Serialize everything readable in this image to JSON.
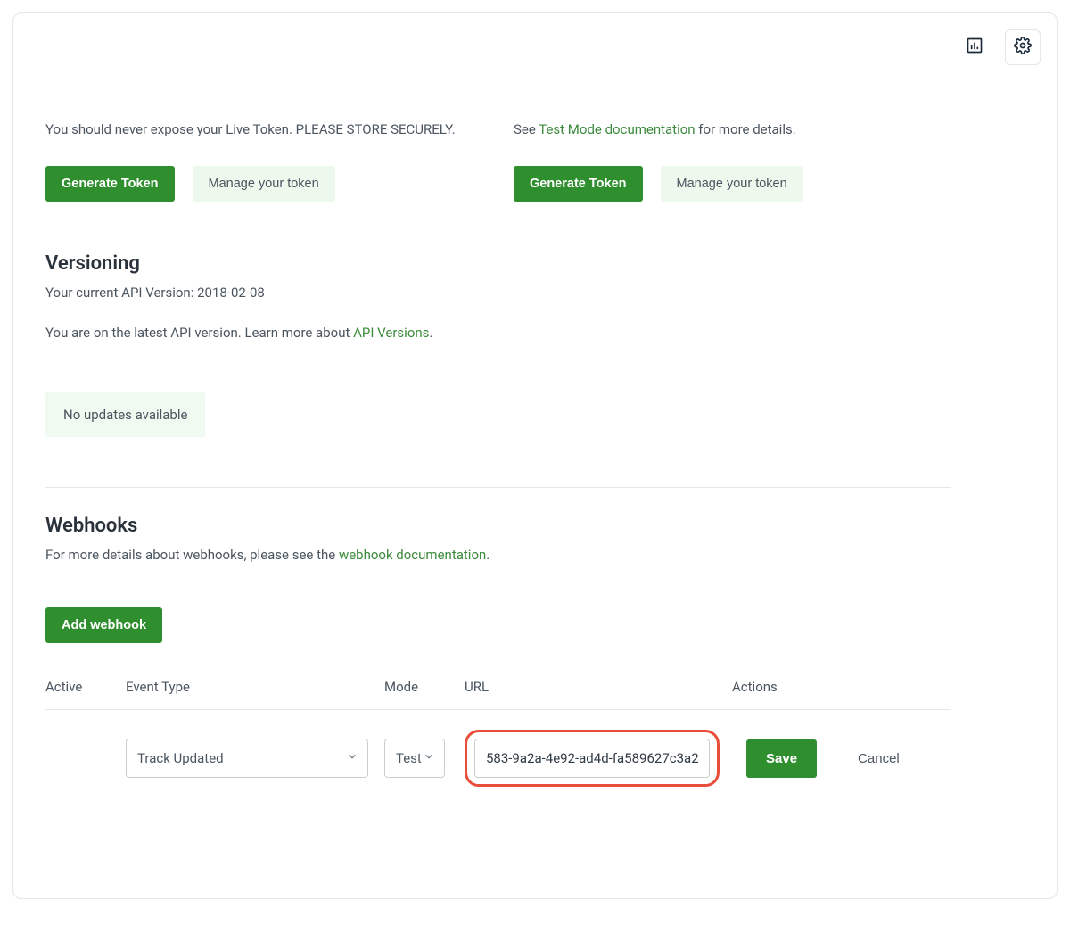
{
  "tokens": {
    "live_desc": "You should never expose your Live Token. PLEASE STORE SECURELY.",
    "test_desc_prefix": "See ",
    "test_desc_link": "Test Mode documentation",
    "test_desc_suffix": " for more details.",
    "generate_label": "Generate Token",
    "manage_label": "Manage your token"
  },
  "versioning": {
    "title": "Versioning",
    "current_prefix": "Your current API Version: ",
    "current_value": "2018-02-08",
    "latest_prefix": "You are on the latest API version. Learn more about ",
    "latest_link": "API Versions",
    "latest_suffix": ".",
    "no_updates": "No updates available"
  },
  "webhooks": {
    "title": "Webhooks",
    "desc_prefix": "For more details about webhooks, please see the ",
    "desc_link": "webhook documentation",
    "desc_suffix": ".",
    "add_label": "Add webhook",
    "headers": {
      "active": "Active",
      "event_type": "Event Type",
      "mode": "Mode",
      "url": "URL",
      "actions": "Actions"
    },
    "row": {
      "event_type": "Track Updated",
      "mode": "Test",
      "url": "583-9a2a-4e92-ad4d-fa589627c3a2",
      "save": "Save",
      "cancel": "Cancel"
    }
  }
}
